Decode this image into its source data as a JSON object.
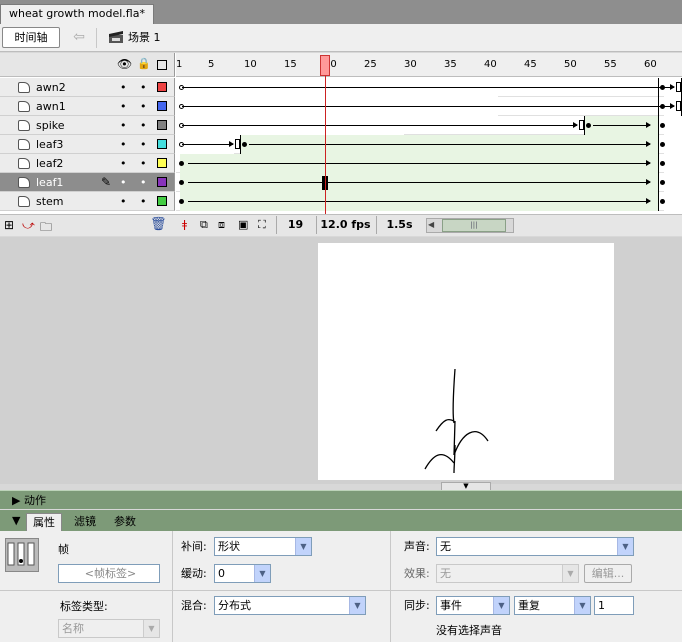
{
  "document": {
    "tab_title": "wheat growth model.fla*"
  },
  "toolbar": {
    "timeline_button": "时间轴",
    "scene_label": "场景 1"
  },
  "timeline": {
    "ruler_ticks": [
      "1",
      "5",
      "10",
      "15",
      "20",
      "25",
      "30",
      "35",
      "40",
      "45",
      "50",
      "55",
      "60"
    ],
    "current_frame": "19",
    "frame_rate": "12.0 fps",
    "elapsed_time": "1.5s",
    "layers": [
      {
        "name": "awn2",
        "color": "#ee4444",
        "eye": "•",
        "lock": "•"
      },
      {
        "name": "awn1",
        "color": "#4466ee",
        "eye": "•",
        "lock": "•"
      },
      {
        "name": "spike",
        "color": "#808080",
        "eye": "•",
        "lock": "•"
      },
      {
        "name": "leaf3",
        "color": "#44dddd",
        "eye": "•",
        "lock": "•"
      },
      {
        "name": "leaf2",
        "color": "#ffff55",
        "eye": "•",
        "lock": "•"
      },
      {
        "name": "leaf1",
        "color": "#8833bb",
        "eye": "•",
        "lock": "•"
      },
      {
        "name": "stem",
        "color": "#44cc44",
        "eye": "•",
        "lock": "•"
      }
    ]
  },
  "panels": {
    "actions_label": "动作",
    "tabs": {
      "properties": "属性",
      "filters": "滤镜",
      "parameters": "参数"
    }
  },
  "properties": {
    "frame_label": "帧",
    "frame_label_placeholder": "<帧标签>",
    "label_type_label": "标签类型:",
    "label_type_value": "名称",
    "tween_label": "补间:",
    "tween_value": "形状",
    "ease_label": "缓动:",
    "ease_value": "0",
    "blend_label": "混合:",
    "blend_value": "分布式",
    "sound_label": "声音:",
    "sound_value": "无",
    "effect_label": "效果:",
    "effect_value": "无",
    "edit_button": "编辑...",
    "sync_label": "同步:",
    "sync_value": "事件",
    "repeat_value": "重复",
    "repeat_count": "1",
    "no_sound_text": "没有选择声音"
  }
}
